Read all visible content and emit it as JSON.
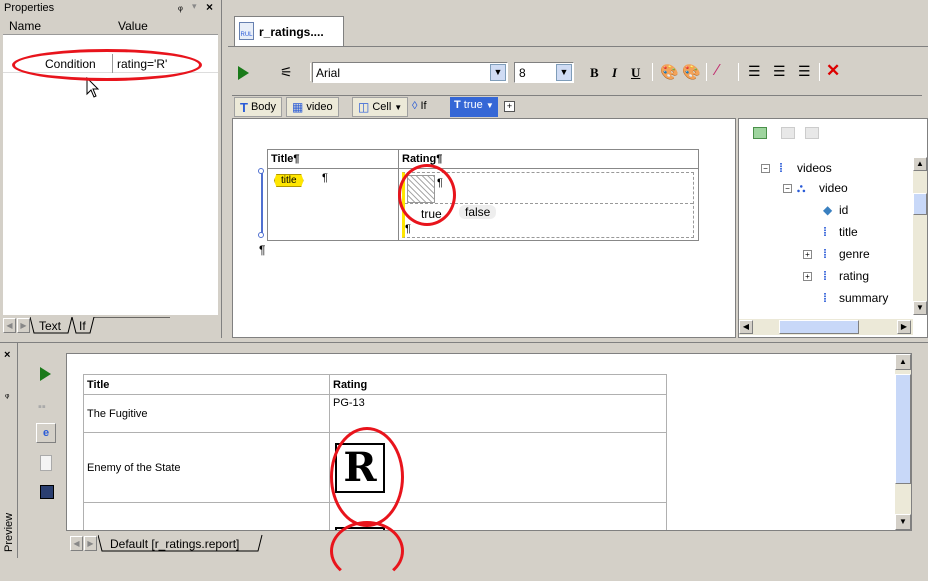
{
  "properties": {
    "title": "Properties",
    "pin": "ᵩ",
    "col_name": "Name",
    "col_value": "Value",
    "row_name": "Condition",
    "row_value": "rating='R'",
    "tab_text": "Text",
    "tab_if": "If"
  },
  "editor": {
    "tab_label": "r_ratings....",
    "font": "Arial",
    "size": "8",
    "bold": "B",
    "italic": "I",
    "underline": "U"
  },
  "breadcrumb": {
    "body": "Body",
    "video": "video",
    "cell": "Cell",
    "if": "If",
    "true": "true"
  },
  "design": {
    "col_title": "Title¶",
    "col_rating": "Rating¶",
    "title_tag": "title",
    "pilcrow": "¶",
    "true_label": "true",
    "false_label": "false"
  },
  "tree": {
    "items": [
      {
        "label": "videos"
      },
      {
        "label": "video"
      },
      {
        "label": "id"
      },
      {
        "label": "title"
      },
      {
        "label": "genre"
      },
      {
        "label": "rating"
      },
      {
        "label": "summary"
      }
    ]
  },
  "preview": {
    "side_label": "Preview",
    "col_title": "Title",
    "col_rating": "Rating",
    "rows": [
      {
        "title": "The Fugitive",
        "rating": "PG-13"
      },
      {
        "title": "Enemy of the State",
        "rating": "R"
      },
      {
        "title": "",
        "rating": "R"
      }
    ],
    "tab_label": "Default [r_ratings.report]"
  },
  "colors": {
    "accent_red": "#e8141c",
    "toolbar_blue": "#2a5bd7"
  }
}
